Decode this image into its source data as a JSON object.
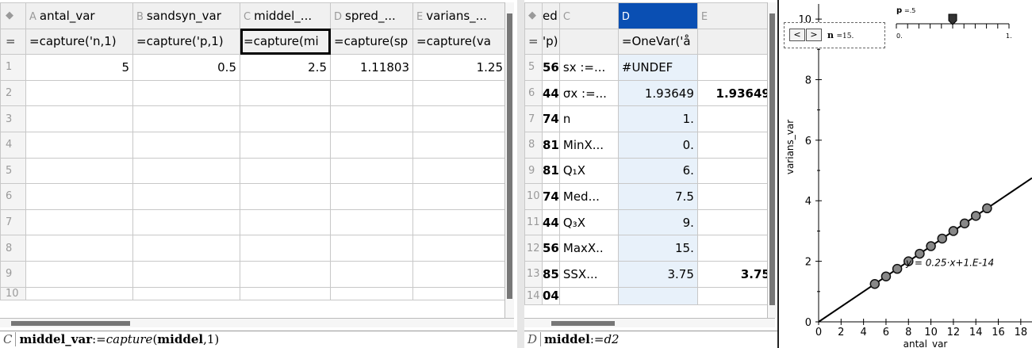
{
  "left_sheet": {
    "columns": [
      {
        "letter": "A",
        "name": "antal_var"
      },
      {
        "letter": "B",
        "name": "sandsyn_var"
      },
      {
        "letter": "C",
        "name": "middel_..."
      },
      {
        "letter": "D",
        "name": "spred_..."
      },
      {
        "letter": "E",
        "name": "varians_..."
      }
    ],
    "formula_marker": "=",
    "formulas": [
      "=capture('n,1)",
      "=capture('p,1)",
      "=capture(mi",
      "=capture(sp",
      "=capture(va"
    ],
    "row_numbers": [
      "1",
      "2",
      "3",
      "4",
      "5",
      "6",
      "7",
      "8",
      "9",
      "10"
    ],
    "row1_values": [
      "5",
      "0.5",
      "2.5",
      "1.11803",
      "1.25"
    ],
    "entry_line": {
      "cell": "C",
      "name": "middel_var",
      "assign": ":=",
      "func": "capture",
      "arg": "middel",
      "rest": ",1)"
    }
  },
  "mid_sheet": {
    "header": {
      "col1": "ed",
      "col2": "C",
      "col3": "D",
      "col4": "E"
    },
    "formula_row": {
      "col1": "'p)",
      "col2": "",
      "col3": "=OneVar('å",
      "col4": ""
    },
    "rows": [
      {
        "rn": "5",
        "a": "56",
        "b": "sx :=...",
        "c": "#UNDEF",
        "d": ""
      },
      {
        "rn": "6",
        "a": "44",
        "b": "σx :=...",
        "c": "1.93649",
        "d": "1.93649"
      },
      {
        "rn": "7",
        "a": "74",
        "b": "n",
        "c": "1.",
        "d": ""
      },
      {
        "rn": "8",
        "a": "81",
        "b": "MinX...",
        "c": "0.",
        "d": ""
      },
      {
        "rn": "9",
        "a": "81",
        "b": "Q₁X",
        "c": "6.",
        "d": ""
      },
      {
        "rn": "10",
        "a": "74",
        "b": "Med...",
        "c": "7.5",
        "d": ""
      },
      {
        "rn": "11",
        "a": "44",
        "b": "Q₃X",
        "c": "9.",
        "d": ""
      },
      {
        "rn": "12",
        "a": "56",
        "b": "MaxX..",
        "c": "15.",
        "d": ""
      },
      {
        "rn": "13",
        "a": "85",
        "b": "SSX...",
        "c": "3.75",
        "d": "3.75"
      },
      {
        "rn": "14",
        "a": "04",
        "b": "",
        "c": "",
        "d": ""
      }
    ],
    "entry_line": {
      "cell": "D",
      "name": "middel",
      "assign": ":=",
      "value": "d2"
    }
  },
  "graph": {
    "slider_p_label": "p",
    "slider_p_value": "=.5",
    "slider_p_min": "0.",
    "slider_p_max": "1.",
    "slider_p_level": 0.5,
    "slider_n_label": "n",
    "slider_n_value": "=15.",
    "button_prev": "<",
    "button_next": ">",
    "regression_label": "y = 0.25·x+1.E-14"
  },
  "chart_data": {
    "type": "scatter",
    "xlabel": "antal_var",
    "ylabel": "varians_var",
    "xlim": [
      0,
      19
    ],
    "ylim": [
      0,
      10.5
    ],
    "x_ticks": [
      0,
      2,
      4,
      6,
      8,
      10,
      12,
      14,
      16,
      18
    ],
    "y_ticks": [
      0,
      2,
      4,
      6,
      8,
      10
    ],
    "points": [
      [
        5,
        1.25
      ],
      [
        6,
        1.5
      ],
      [
        7,
        1.75
      ],
      [
        8,
        2.0
      ],
      [
        9,
        2.25
      ],
      [
        10,
        2.5
      ],
      [
        11,
        2.75
      ],
      [
        12,
        3.0
      ],
      [
        13,
        3.25
      ],
      [
        14,
        3.5
      ],
      [
        15,
        3.75
      ]
    ],
    "regression": {
      "slope": 0.25,
      "intercept": 0
    }
  }
}
